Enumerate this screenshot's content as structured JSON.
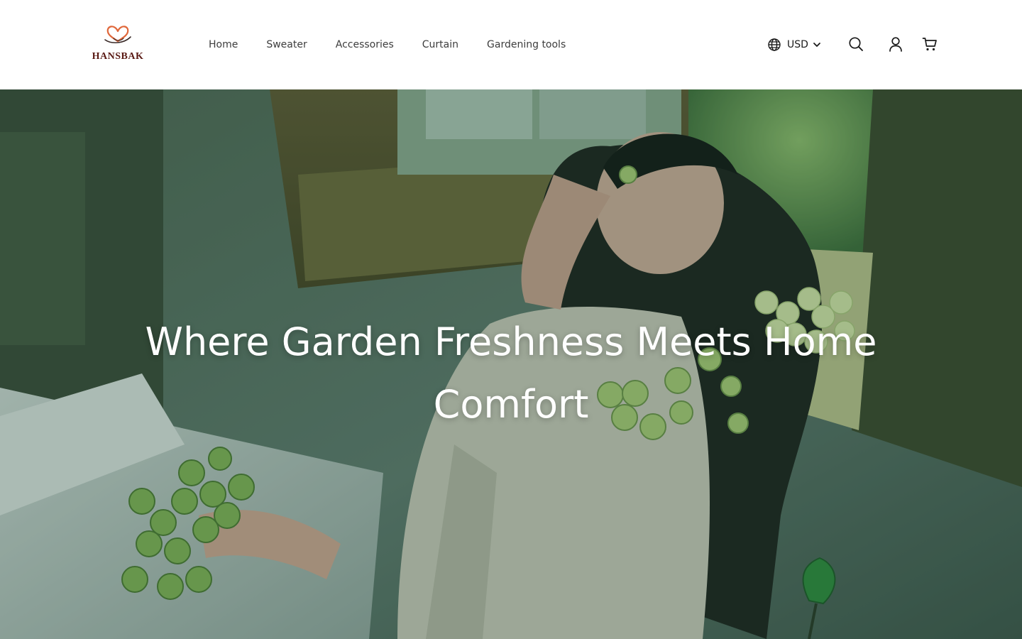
{
  "brand": {
    "name": "HANSBAK"
  },
  "nav": {
    "items": [
      "Home",
      "Sweater",
      "Accessories",
      "Curtain",
      "Gardening tools"
    ]
  },
  "currency": {
    "label": "USD",
    "icon": "globe-icon"
  },
  "header_icons": {
    "search": "search-icon",
    "account": "user-icon",
    "cart": "cart-icon"
  },
  "hero": {
    "title": "Where Garden Freshness Meets Home Comfort",
    "image_description": "photo"
  },
  "colors": {
    "brand_text": "#5a1a14",
    "heart": "#e0673a",
    "text": "#3d3d3d",
    "hero_tint": "#143c32"
  }
}
